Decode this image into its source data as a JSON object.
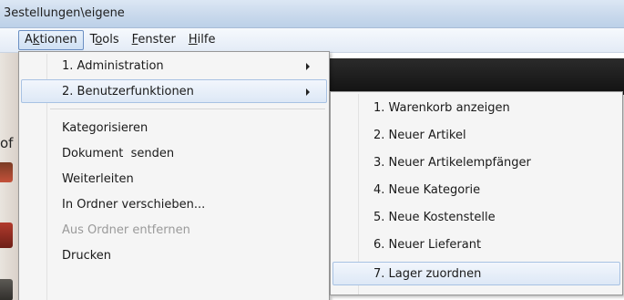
{
  "window": {
    "title": "3estellungen\\eigene"
  },
  "menubar": {
    "items": [
      {
        "pre": "A",
        "mnemonic": "k",
        "post": "tionen"
      },
      {
        "pre": "T",
        "mnemonic": "o",
        "post": "ols"
      },
      {
        "pre": "",
        "mnemonic": "F",
        "post": "enster"
      },
      {
        "pre": "",
        "mnemonic": "H",
        "post": "ilfe"
      }
    ]
  },
  "background": {
    "edge_letter": "of"
  },
  "menu": {
    "items": [
      {
        "label": "1. Administration",
        "submenu": true
      },
      {
        "label": "2. Benutzerfunktionen",
        "submenu": true
      },
      {
        "label": "Kategorisieren"
      },
      {
        "label": "Dokument  senden"
      },
      {
        "label": "Weiterleiten"
      },
      {
        "label": "In Ordner verschieben..."
      },
      {
        "label": "Aus Ordner entfernen",
        "disabled": true
      },
      {
        "label": "Drucken"
      }
    ]
  },
  "submenu": {
    "items": [
      {
        "label": "1. Warenkorb anzeigen"
      },
      {
        "label": "2. Neuer Artikel"
      },
      {
        "label": "3. Neuer Artikelempfänger"
      },
      {
        "label": "4. Neue Kategorie"
      },
      {
        "label": "5. Neue Kostenstelle"
      },
      {
        "label": "6. Neuer Lieferant"
      },
      {
        "label": "7. Lager zuordnen",
        "highlighted": true
      }
    ]
  },
  "colors": {
    "highlight": "#dde8f6",
    "highlight_border": "#a8c2e3",
    "menu_background": "#f5f5f5",
    "disabled_text": "#9a9a9a"
  }
}
